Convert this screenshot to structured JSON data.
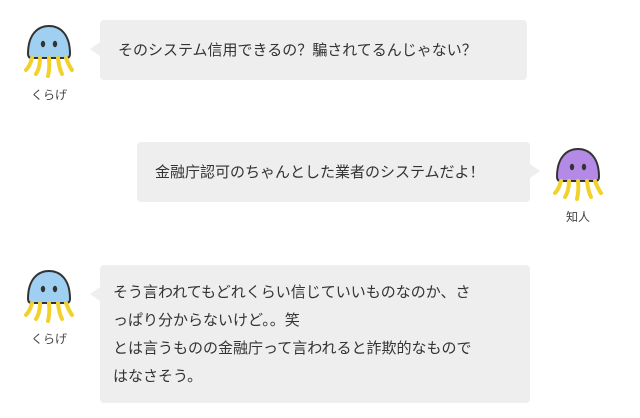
{
  "colors": {
    "bubble_bg": "#eeeeee",
    "text": "#333333",
    "jellyfish_blue": "#9fd0f2",
    "jellyfish_purple": "#b48ae6",
    "tentacle_yellow": "#f2d12c"
  },
  "messages": [
    {
      "side": "left",
      "speaker": "くらげ",
      "avatar_icon": "blue-jellyfish-icon",
      "lines": [
        "そのシステム信用できるの？騙されてるんじゃない？"
      ]
    },
    {
      "side": "right",
      "speaker": "知人",
      "avatar_icon": "purple-jellyfish-icon",
      "lines": [
        "金融庁認可のちゃんとした業者のシステムだよ！"
      ]
    },
    {
      "side": "left",
      "speaker": "くらげ",
      "avatar_icon": "blue-jellyfish-icon",
      "lines": [
        "そう言われてもどれくらい信じていいものなのか、さ",
        "っぱり分からないけど。。笑",
        "とは言うものの金融庁って言われると詐欺的なもので",
        "はなさそう。"
      ]
    }
  ]
}
